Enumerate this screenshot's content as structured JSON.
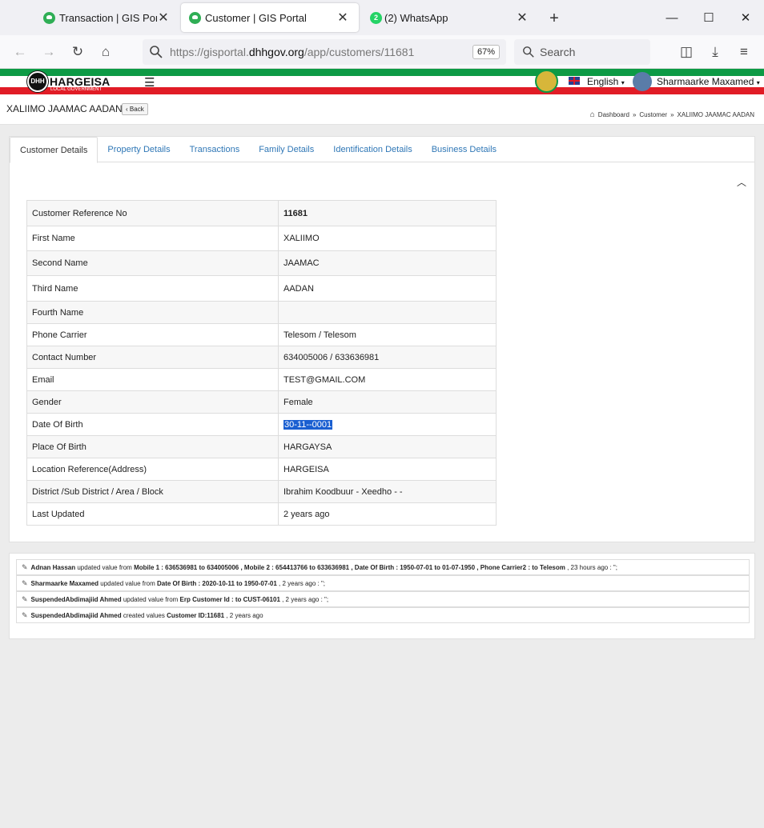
{
  "browser": {
    "tabs": [
      {
        "label": "Transaction | GIS Portal",
        "active": false
      },
      {
        "label": "Customer | GIS Portal",
        "active": true
      },
      {
        "label": "(2) WhatsApp",
        "active": false,
        "badge": "2"
      }
    ],
    "url_prefix": "https://gisportal.",
    "url_domain": "dhhgov.org",
    "url_path": "/app/customers/11681",
    "zoom": "67%",
    "search_placeholder": "Search"
  },
  "header": {
    "logo_text": "HARGEISA",
    "logo_subtext": "LOCAL GOVERNMENT",
    "logo_initials": "DHH",
    "language": "English",
    "user_name": "Sharmaarke Maxamed"
  },
  "page": {
    "title": "XALIIMO JAAMAC AADAN",
    "back_label": "Back",
    "breadcrumbs": [
      "Dashboard",
      "Customer",
      "XALIIMO JAAMAC AADAN"
    ]
  },
  "tabs": [
    {
      "label": "Customer Details",
      "active": true
    },
    {
      "label": "Property Details",
      "active": false
    },
    {
      "label": "Transactions",
      "active": false
    },
    {
      "label": "Family Details",
      "active": false
    },
    {
      "label": "Identification Details",
      "active": false
    },
    {
      "label": "Business Details",
      "active": false
    }
  ],
  "customer": {
    "rows": [
      {
        "key": "Customer Reference No",
        "value": "11681",
        "bold": true
      },
      {
        "key": "First Name",
        "value": "XALIIMO"
      },
      {
        "key": "Second Name",
        "value": "JAAMAC"
      },
      {
        "key": "Third Name",
        "value": "AADAN"
      },
      {
        "key": "Fourth Name",
        "value": ""
      },
      {
        "key": "Phone Carrier",
        "value": "Telesom / Telesom"
      },
      {
        "key": "Contact Number",
        "value": "634005006 / 633636981"
      },
      {
        "key": "Email",
        "value": "TEST@GMAIL.COM"
      },
      {
        "key": "Gender",
        "value": "Female"
      },
      {
        "key": "Date Of Birth",
        "value": "30-11--0001",
        "selected": true
      },
      {
        "key": "Place Of Birth",
        "value": "HARGAYSA"
      },
      {
        "key": "Location Reference(Address)",
        "value": "HARGEISA"
      },
      {
        "key": "District /Sub District / Area / Block",
        "value": "Ibrahim Koodbuur - Xeedho - -"
      },
      {
        "key": "Last Updated",
        "value": "2 years ago"
      }
    ]
  },
  "log": [
    {
      "parts": [
        {
          "t": "Adnan Hassan",
          "b": true
        },
        {
          "t": " updated value from ",
          "b": false
        },
        {
          "t": "Mobile 1 : 636536981 to 634005006 , Mobile 2 : 654413766 to 633636981 , Date Of Birth : 1950-07-01 to 01-07-1950 , Phone Carrier2 : to Telesom",
          "b": true
        },
        {
          "t": " , 23 hours ago : \";",
          "b": false
        }
      ]
    },
    {
      "parts": [
        {
          "t": "Sharmaarke Maxamed",
          "b": true
        },
        {
          "t": " updated value from ",
          "b": false
        },
        {
          "t": "Date Of Birth : 2020-10-11 to 1950-07-01",
          "b": true
        },
        {
          "t": " , 2 years ago : \";",
          "b": false
        }
      ]
    },
    {
      "parts": [
        {
          "t": "SuspendedAbdimajiid Ahmed",
          "b": true
        },
        {
          "t": " updated value from ",
          "b": false
        },
        {
          "t": "Erp Customer Id : to CUST-06101",
          "b": true
        },
        {
          "t": " , 2 years ago : \";",
          "b": false
        }
      ]
    },
    {
      "parts": [
        {
          "t": "SuspendedAbdimajiid Ahmed",
          "b": true
        },
        {
          "t": " created values ",
          "b": false
        },
        {
          "t": "Customer ID:11681",
          "b": true
        },
        {
          "t": " , 2 years ago",
          "b": false
        }
      ]
    }
  ]
}
